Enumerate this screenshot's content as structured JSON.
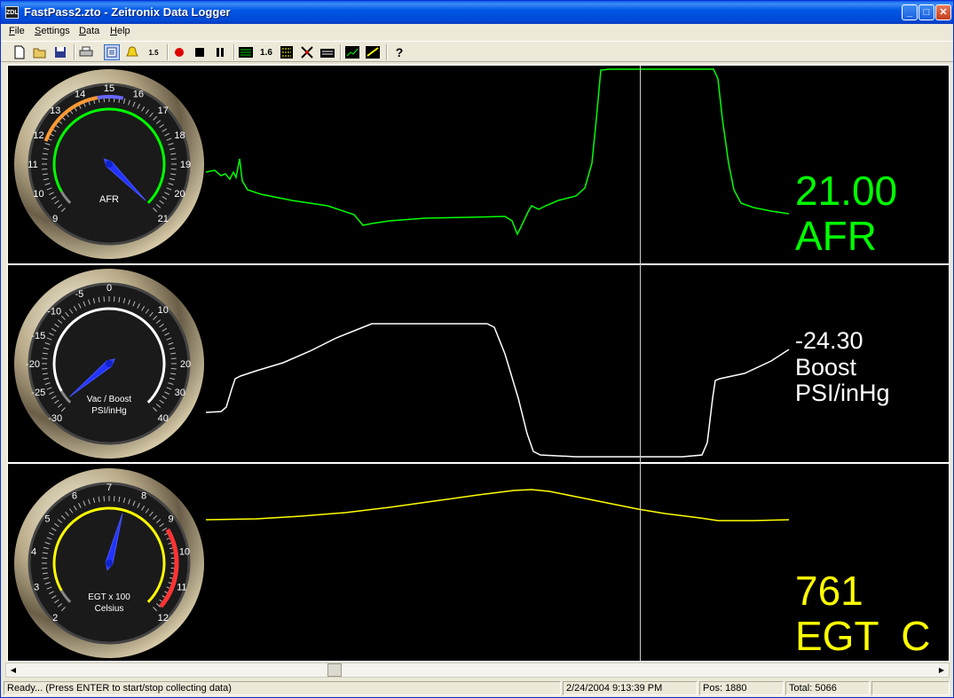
{
  "window": {
    "title": "FastPass2.zto - Zeitronix Data Logger",
    "icon_text": "ZDL"
  },
  "menu": [
    {
      "label": "File",
      "accel": "F",
      "rest": "ile"
    },
    {
      "label": "Settings",
      "accel": "S",
      "rest": "ettings"
    },
    {
      "label": "Data",
      "accel": "D",
      "rest": "ata"
    },
    {
      "label": "Help",
      "accel": "H",
      "rest": "elp"
    }
  ],
  "toolbar": {
    "icons": [
      "new-file-icon",
      "open-folder-icon",
      "save-icon",
      "print-icon",
      "view-list-icon",
      "alarm-bell-icon",
      "scale-icon",
      "record-icon",
      "stop-icon",
      "pause-icon",
      "bars-icon",
      "digits-icon",
      "list-icon",
      "grid-icon",
      "range-icon",
      "chart-icon",
      "chart-edit-icon",
      "help-icon"
    ],
    "digits_label": "1.6",
    "scale_label": "1.5"
  },
  "colors": {
    "afr": "#00ff00",
    "boost": "#ffffff",
    "egt": "#ffff00"
  },
  "gauges": {
    "afr": {
      "label": "AFR",
      "ticks": [
        "9",
        "10",
        "11",
        "12",
        "13",
        "14",
        "15",
        "16",
        "17",
        "18",
        "19",
        "20",
        "21"
      ]
    },
    "boost": {
      "label": "Vac / Boost",
      "label2": "PSI/inHg",
      "ticks": [
        "-30",
        "-25",
        "-20",
        "-15",
        "-10",
        "-5",
        "0",
        "10",
        "20",
        "30",
        "40"
      ]
    },
    "egt": {
      "label": "EGT x 100",
      "label2": "Celsius",
      "ticks": [
        "2",
        "3",
        "4",
        "5",
        "6",
        "7",
        "8",
        "9",
        "10",
        "11",
        "12"
      ]
    }
  },
  "readouts": {
    "afr": {
      "value": "21.00",
      "unit": "AFR"
    },
    "boost": {
      "value": "-24.30",
      "unit": "Boost",
      "unit2": "PSI/inHg"
    },
    "egt": {
      "value": "761",
      "unit": "EGT  C"
    }
  },
  "status": {
    "message": "Ready... (Press ENTER to start/stop collecting data)",
    "datetime": "2/24/2004 9:13:39 PM",
    "pos": "Pos: 1880",
    "total": "Total: 5066"
  }
}
